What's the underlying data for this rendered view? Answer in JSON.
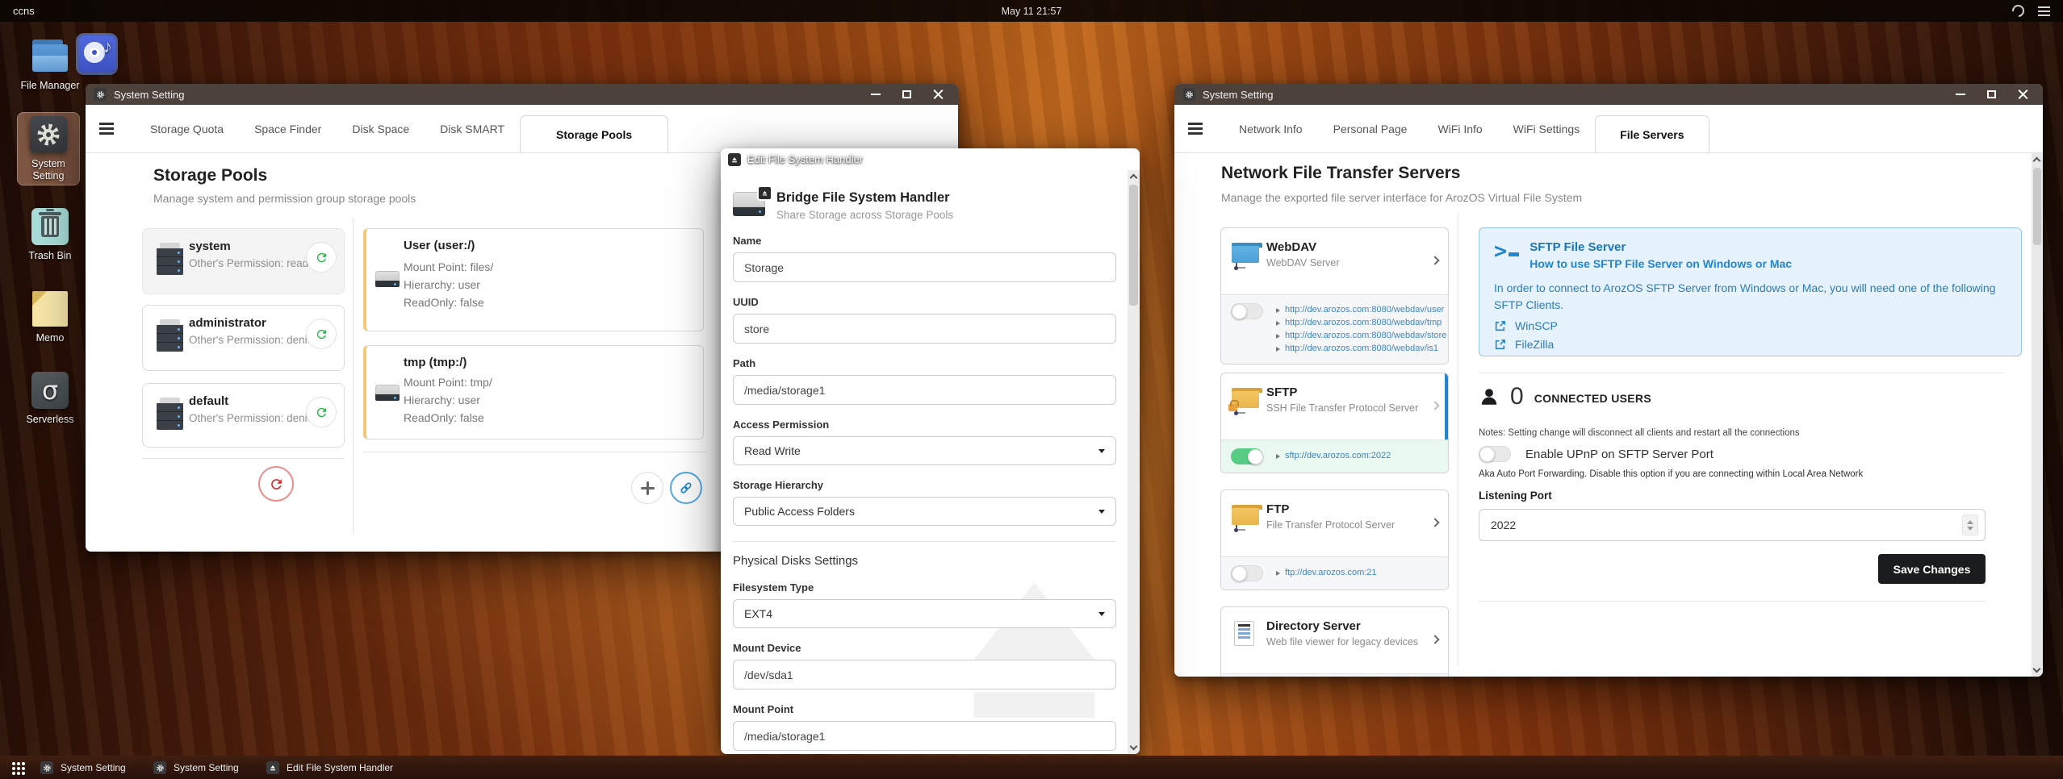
{
  "topbar": {
    "host": "ccns",
    "clock": "May 11 21:57"
  },
  "icons": {
    "music_note": "♪",
    "serverless_glyph": "σ"
  },
  "desktop": {
    "file_manager": "File Manager",
    "system_setting": "System Setting",
    "trash_bin": "Trash Bin",
    "memo": "Memo",
    "serverless": "Serverless"
  },
  "window_storage": {
    "title": "System Setting",
    "tabs": [
      "Storage Quota",
      "Space Finder",
      "Disk Space",
      "Disk SMART",
      "Storage Pools"
    ],
    "heading": "Storage Pools",
    "subheading": "Manage system and permission group storage pools",
    "pools": [
      {
        "name": "system",
        "permission": "Other's Permission: readwrite"
      },
      {
        "name": "administrator",
        "permission": "Other's Permission: denied"
      },
      {
        "name": "default",
        "permission": "Other's Permission: denied"
      }
    ],
    "details": [
      {
        "title": "User (user:/)",
        "mount": "Mount Point: files/",
        "hierarchy": "Hierarchy: user",
        "readonly": "ReadOnly: false"
      },
      {
        "title": "tmp (tmp:/)",
        "mount": "Mount Point: tmp/",
        "hierarchy": "Hierarchy: user",
        "readonly": "ReadOnly: false"
      }
    ]
  },
  "window_editor": {
    "title": "Edit File System Handler",
    "header_title": "Bridge File System Handler",
    "header_sub": "Share Storage across Storage Pools",
    "fields": {
      "name_label": "Name",
      "name_value": "Storage",
      "uuid_label": "UUID",
      "uuid_value": "store",
      "path_label": "Path",
      "path_value": "/media/storage1",
      "access_label": "Access Permission",
      "access_value": "Read Write",
      "hierarchy_label": "Storage Hierarchy",
      "hierarchy_value": "Public Access Folders",
      "section_label": "Physical Disks Settings",
      "fstype_label": "Filesystem Type",
      "fstype_value": "EXT4",
      "mountdev_label": "Mount Device",
      "mountdev_value": "/dev/sda1",
      "mountpoint_label": "Mount Point",
      "mountpoint_value": "/media/storage1"
    }
  },
  "window_servers": {
    "title": "System Setting",
    "tabs": [
      "Network Info",
      "Personal Page",
      "WiFi Info",
      "WiFi Settings",
      "File Servers"
    ],
    "heading": "Network File Transfer Servers",
    "subheading": "Manage the exported file server interface for ArozOS Virtual File System",
    "webdav": {
      "name": "WebDAV",
      "desc": "WebDAV Server",
      "links": [
        "http://dev.arozos.com:8080/webdav/user",
        "http://dev.arozos.com:8080/webdav/tmp",
        "http://dev.arozos.com:8080/webdav/store",
        "http://dev.arozos.com:8080/webdav/is1"
      ]
    },
    "sftp": {
      "name": "SFTP",
      "desc": "SSH File Transfer Protocol Server",
      "link": "sftp://dev.arozos.com:2022"
    },
    "ftp": {
      "name": "FTP",
      "desc": "File Transfer Protocol Server",
      "link": "ftp://dev.arozos.com:21"
    },
    "dirserver": {
      "name": "Directory Server",
      "desc": "Web file viewer for legacy devices"
    },
    "info_box": {
      "title": "SFTP File Server",
      "subtitle": "How to use SFTP File Server on Windows or Mac",
      "body": "In order to connect to ArozOS SFTP Server from Windows or Mac, you will need one of the following SFTP Clients.",
      "clients": [
        "WinSCP",
        "FileZilla"
      ]
    },
    "connected": {
      "count": "0",
      "label": "CONNECTED USERS",
      "notes": "Notes: Setting change will disconnect all clients and restart all the connections"
    },
    "upnp": {
      "label": "Enable UPnP on SFTP Server Port",
      "desc": "Aka Auto Port Forwarding. Disable this option if you are connecting within Local Area Network"
    },
    "port": {
      "label": "Listening Port",
      "value": "2022"
    },
    "save_label": "Save Changes"
  },
  "taskbar": {
    "items": [
      "System Setting",
      "System Setting",
      "Edit File System Handler"
    ]
  }
}
